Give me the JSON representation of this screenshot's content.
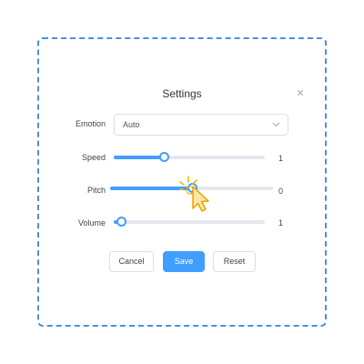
{
  "dialog": {
    "title": "Settings",
    "close_icon": "close-icon"
  },
  "emotion": {
    "label": "Emotion",
    "value": "Auto",
    "icon": "chevron-down-icon"
  },
  "speed": {
    "label": "Speed",
    "value": "1",
    "level": 0.33
  },
  "pitch": {
    "label": "Pitch",
    "value": "0",
    "level": 0.5
  },
  "volume": {
    "label": "Volume",
    "value": "1",
    "level": 0.05
  },
  "buttons": {
    "cancel": "Cancel",
    "save": "Save",
    "reset": "Reset"
  },
  "colors": {
    "accent": "#409eff",
    "frame": "#4a90e2",
    "cursor": "#f5b800"
  }
}
